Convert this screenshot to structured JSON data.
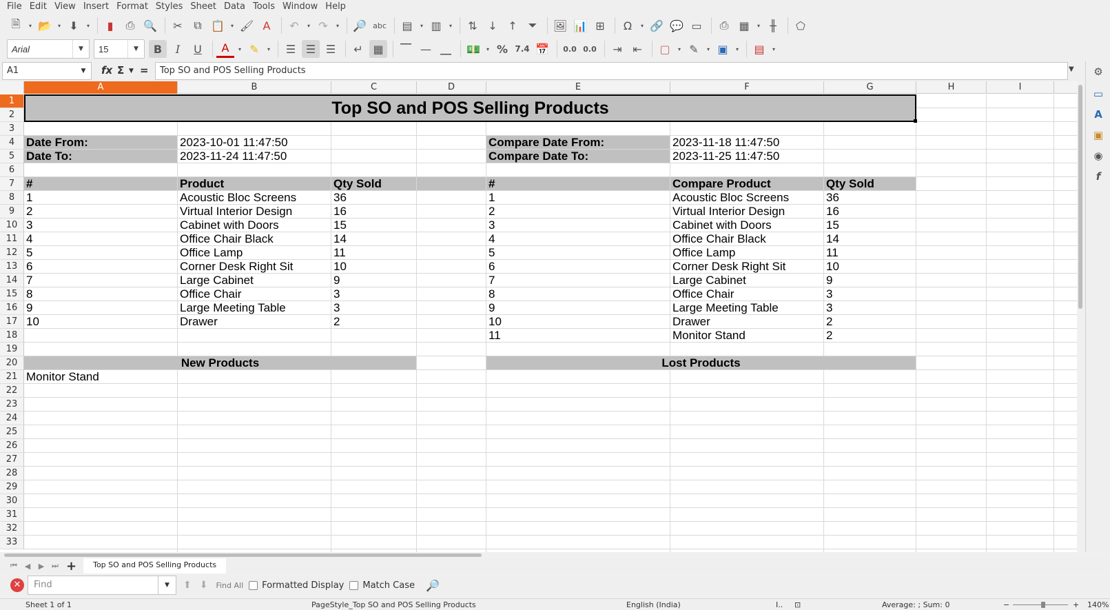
{
  "menu": [
    "File",
    "Edit",
    "View",
    "Insert",
    "Format",
    "Styles",
    "Sheet",
    "Data",
    "Tools",
    "Window",
    "Help"
  ],
  "toolbar": {
    "font_name": "Arial",
    "font_size": "15",
    "number_percent": "%",
    "number_decimal": "7.4",
    "add_decimal": "0.0",
    "del_decimal": "0.0",
    "omega": "Ω"
  },
  "formula_bar": {
    "cell_ref": "A1",
    "fx_label": "fx",
    "sigma_label": "Σ",
    "equals_label": "=",
    "content": "Top SO and POS Selling Products"
  },
  "columns": [
    "A",
    "B",
    "C",
    "D",
    "E",
    "F",
    "G",
    "H",
    "I"
  ],
  "rows": [
    "1",
    "2",
    "3",
    "4",
    "5",
    "6",
    "7",
    "8",
    "9",
    "10",
    "11",
    "12",
    "13",
    "14",
    "15",
    "16",
    "17",
    "18",
    "19",
    "20",
    "21",
    "22",
    "23",
    "24",
    "25",
    "26",
    "27",
    "28",
    "29",
    "30",
    "31",
    "32",
    "33"
  ],
  "sheet": {
    "title": "Top SO and POS Selling Products",
    "date_from_label": "Date From:",
    "date_from": "2023-10-01 11:47:50",
    "date_to_label": "Date To:",
    "date_to": "2023-11-24 11:47:50",
    "compare_from_label": "Compare Date From:",
    "compare_from": "2023-11-18 11:47:50",
    "compare_to_label": "Compare Date To:",
    "compare_to": "2023-11-25 11:47:50",
    "left_headers": [
      "#",
      "Product",
      "Qty Sold"
    ],
    "right_headers": [
      "#",
      "Compare Product",
      "Qty Sold"
    ],
    "left_rows": [
      [
        "1",
        "Acoustic Bloc Screens",
        "36"
      ],
      [
        "2",
        "Virtual Interior Design",
        "16"
      ],
      [
        "3",
        "Cabinet with Doors",
        "15"
      ],
      [
        "4",
        "Office Chair Black",
        "14"
      ],
      [
        "5",
        "Office Lamp",
        "11"
      ],
      [
        "6",
        "Corner Desk Right Sit",
        "10"
      ],
      [
        "7",
        "Large Cabinet",
        "9"
      ],
      [
        "8",
        "Office Chair",
        "3"
      ],
      [
        "9",
        "Large Meeting Table",
        "3"
      ],
      [
        "10",
        "Drawer",
        "2"
      ]
    ],
    "right_rows": [
      [
        "1",
        "Acoustic Bloc Screens",
        "36"
      ],
      [
        "2",
        "Virtual Interior Design",
        "16"
      ],
      [
        "3",
        "Cabinet with Doors",
        "15"
      ],
      [
        "4",
        "Office Chair Black",
        "14"
      ],
      [
        "5",
        "Office Lamp",
        "11"
      ],
      [
        "6",
        "Corner Desk Right Sit",
        "10"
      ],
      [
        "7",
        "Large Cabinet",
        "9"
      ],
      [
        "8",
        "Office Chair",
        "3"
      ],
      [
        "9",
        "Large Meeting Table",
        "3"
      ],
      [
        "10",
        "Drawer",
        "2"
      ],
      [
        "11",
        "Monitor Stand",
        "2"
      ]
    ],
    "new_products_label": "New Products",
    "new_products": [
      "Monitor Stand"
    ],
    "lost_products_label": "Lost Products"
  },
  "tabs": {
    "sheet_name": "Top SO and POS Selling Products"
  },
  "findbar": {
    "placeholder": "Find",
    "find_all": "Find All",
    "formatted_display": "Formatted Display",
    "match_case": "Match Case"
  },
  "status": {
    "sheet_pos": "Sheet 1 of 1",
    "page_style": "PageStyle_Top SO and POS Selling Products",
    "language": "English (India)",
    "summary": "Average: ; Sum: 0",
    "zoom": "140%"
  },
  "colors": {
    "selection_header": "#ee6a1e",
    "header_fill": "#c0c0c0"
  }
}
